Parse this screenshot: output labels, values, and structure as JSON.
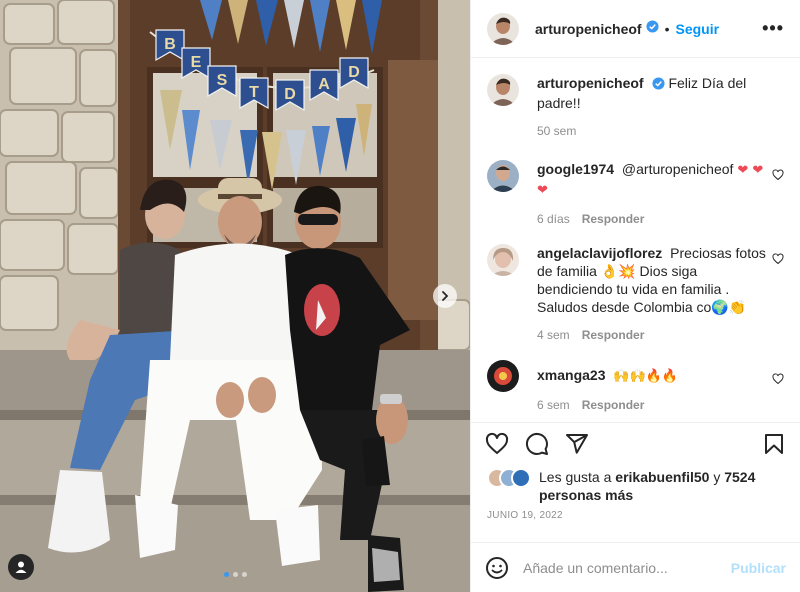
{
  "post": {
    "author": "arturopenicheof",
    "follow_label": "Seguir",
    "separator": "•",
    "more_label": "•••",
    "caption": {
      "user": "arturopenicheof",
      "text": "Feliz Día del padre!!",
      "time": "50 sem"
    },
    "banner_letters": [
      "B",
      "E",
      "S",
      "T",
      "D",
      "A",
      "D"
    ],
    "carousel": {
      "dots": 3,
      "active": 0
    }
  },
  "comments": [
    {
      "user": "google1974",
      "mention": "@arturopenicheof",
      "text": " ",
      "emoji": "❤ ❤❤",
      "time": "6 días",
      "reply": "Responder"
    },
    {
      "user": "angelaclavijoflorez",
      "text": "Preciosas fotos de familia 👌💥 Dios siga bendiciendo tu vida en familia . Saludos desde Colombia co🌍👏",
      "time": "4 sem",
      "reply": "Responder"
    },
    {
      "user": "xmanga23",
      "text": "🙌🙌🔥🔥",
      "time": "6 sem",
      "reply": "Responder"
    }
  ],
  "likes": {
    "prefix": "Les gusta a",
    "user": "erikabuenfil50",
    "joiner": "y",
    "count_text": "7524 personas más"
  },
  "date": "JUNIO 19, 2022",
  "composer": {
    "placeholder": "Añade un comentario...",
    "publish_label": "Publicar"
  },
  "colors": {
    "accent": "#0095f6",
    "heart": "#ed4956",
    "publish_disabled": "#b2dffc",
    "verified": "#3897f0"
  },
  "icons": {
    "like": "heart-icon",
    "comment": "comment-icon",
    "share": "share-icon",
    "save": "bookmark-icon",
    "emoji": "smiley-icon",
    "next": "chevron-right-icon",
    "tag": "user-tag-icon"
  }
}
